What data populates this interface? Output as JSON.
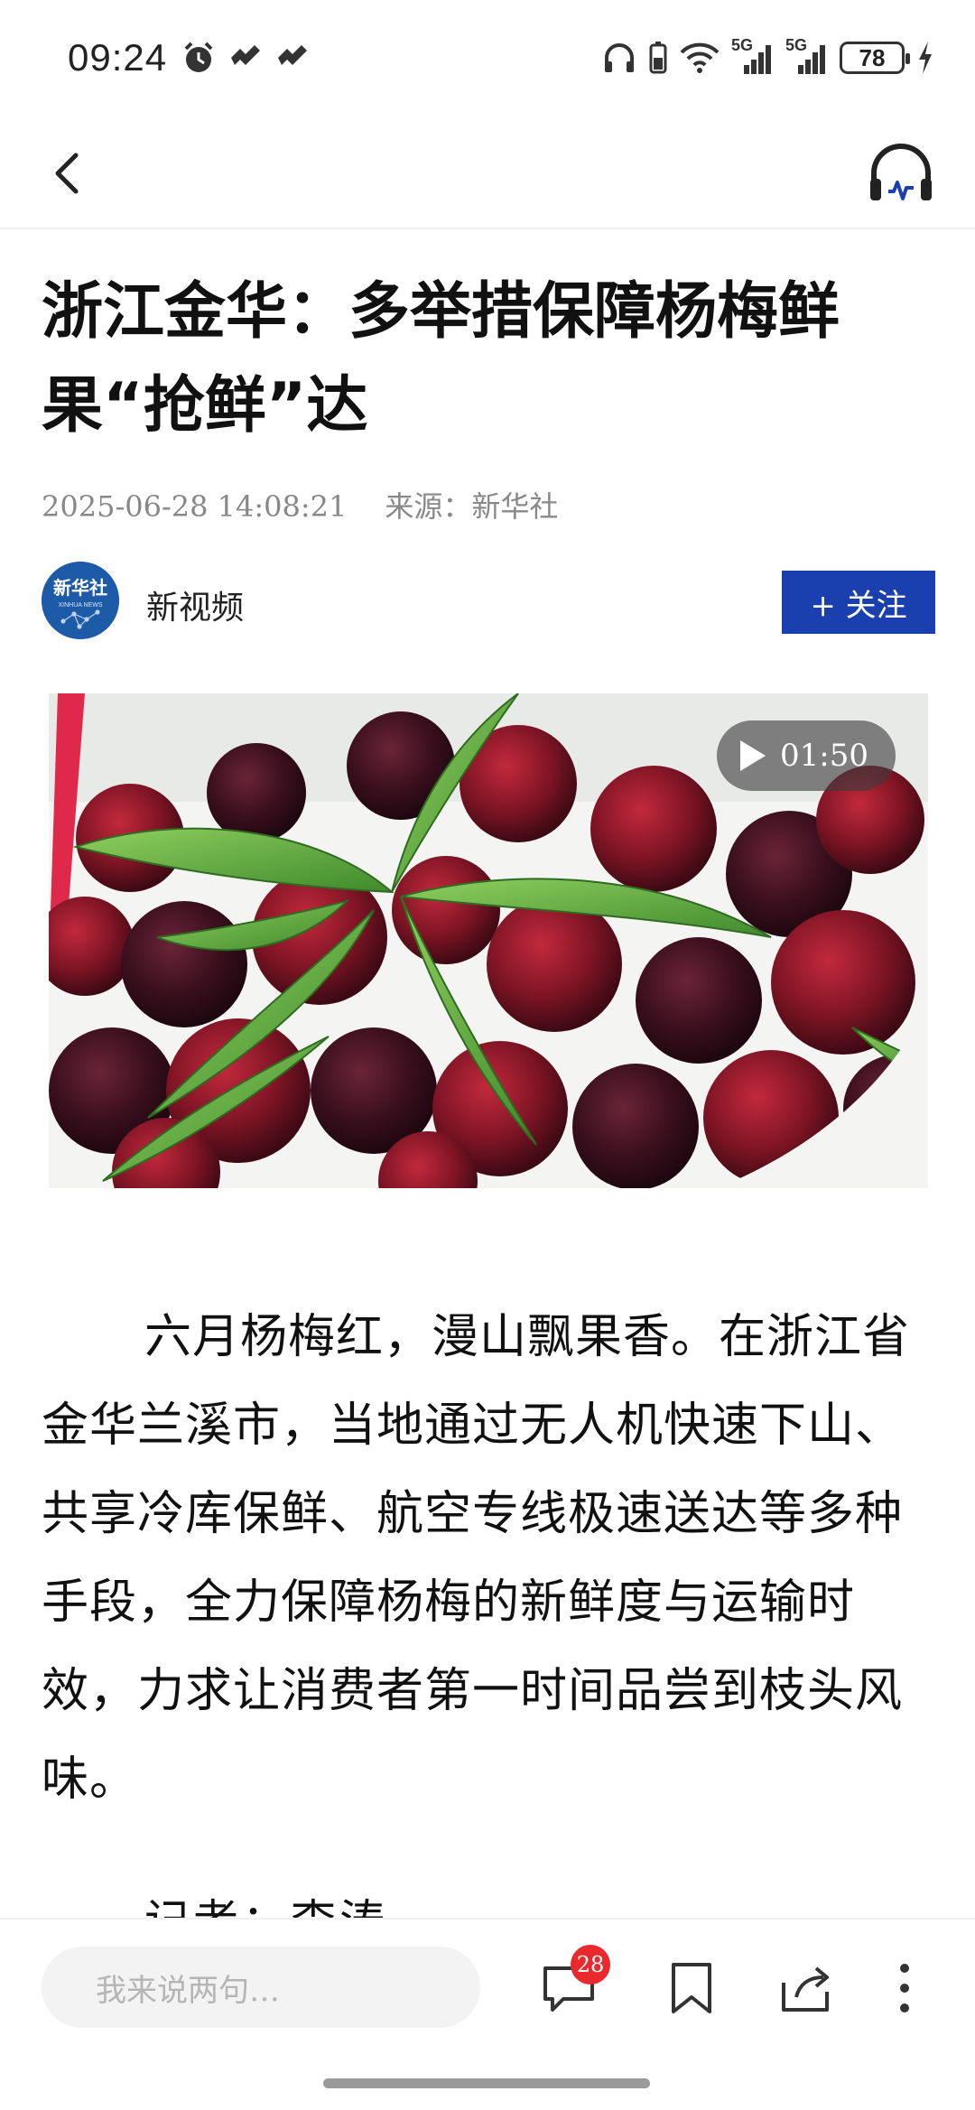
{
  "status_bar": {
    "time": "09:24",
    "battery": "78",
    "network_1": "5G",
    "network_2": "5G"
  },
  "nav": {
    "back_icon": "chevron-left-icon",
    "listen_icon": "headphones-icon"
  },
  "article": {
    "title": "浙江金华：多举措保障杨梅鲜果“抢鲜”达",
    "date": "2025-06-28 14:08:21",
    "source": "来源：新华社",
    "author": {
      "name": "新视频",
      "avatar_label": "新华社",
      "avatar_sub": "XINHUA NEWS",
      "follow_label": "+ 关注"
    },
    "video": {
      "duration": "01:50"
    },
    "body": "六月杨梅红，漫山飘果香。在浙江省金华兰溪市，当地通过无人机快速下山、共享冷库保鲜、航空专线极速送达等多种手段，全力保障杨梅的新鲜度与运输时效，力求让消费者第一时间品尝到枝头风味。",
    "reporter": "记者：李涛"
  },
  "bottom_bar": {
    "comment_placeholder": "我来说两句…",
    "comment_count": "28"
  },
  "colors": {
    "accent": "#1a40b0",
    "badge": "#e8292e",
    "meta_text": "#888888"
  }
}
